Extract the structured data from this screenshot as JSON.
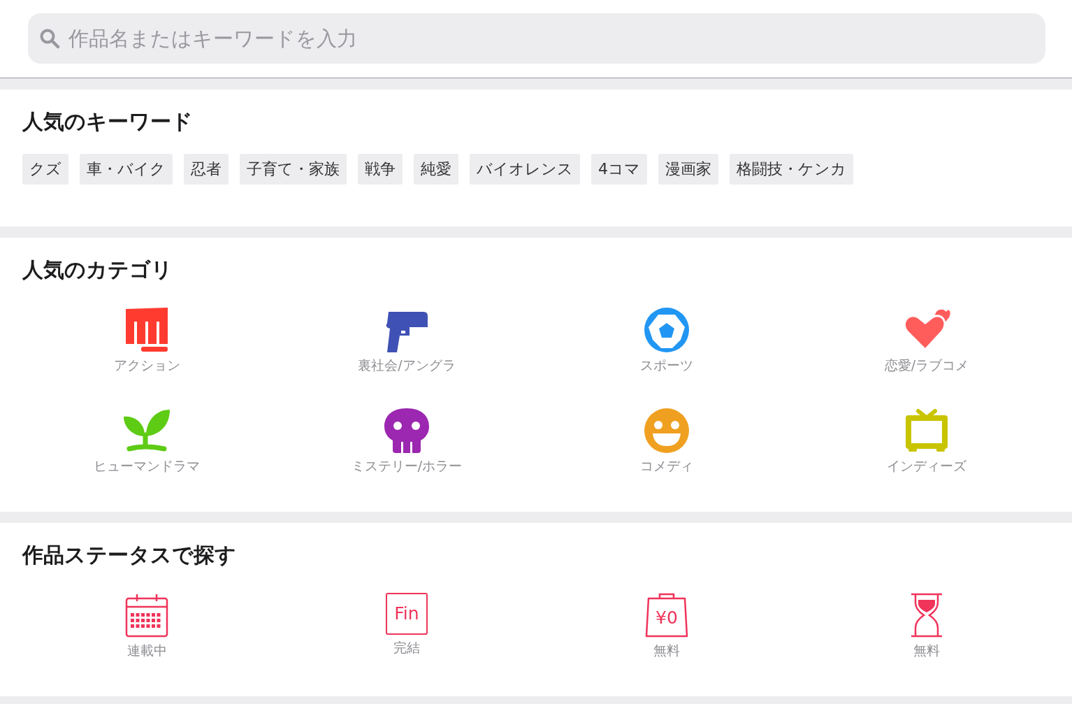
{
  "search": {
    "placeholder": "作品名またはキーワードを入力"
  },
  "keywords": {
    "title": "人気のキーワード",
    "items": [
      "クズ",
      "車・バイク",
      "忍者",
      "子育て・家族",
      "戦争",
      "純愛",
      "バイオレンス",
      "4コマ",
      "漫画家",
      "格闘技・ケンカ"
    ]
  },
  "categories": {
    "title": "人気のカテゴリ",
    "items": [
      {
        "kind": "fist",
        "label": "アクション",
        "color": "#ff3b30"
      },
      {
        "kind": "gun",
        "label": "裏社会/アングラ",
        "color": "#3f51b5"
      },
      {
        "kind": "ball",
        "label": "スポーツ",
        "color": "#2196f3"
      },
      {
        "kind": "hearts",
        "label": "恋愛/ラブコメ",
        "color": "#ff5c5c"
      },
      {
        "kind": "sprout",
        "label": "ヒューマンドラマ",
        "color": "#5ecb14"
      },
      {
        "kind": "skull",
        "label": "ミステリー/ホラー",
        "color": "#9c27b0"
      },
      {
        "kind": "smile",
        "label": "コメディ",
        "color": "#f0a020"
      },
      {
        "kind": "tv",
        "label": "インディーズ",
        "color": "#c8c400"
      }
    ]
  },
  "statuses": {
    "title": "作品ステータスで探す",
    "items": [
      {
        "kind": "calendar",
        "label": "連載中"
      },
      {
        "kind": "fin",
        "icon_text": "Fin",
        "label": "完結"
      },
      {
        "kind": "bag",
        "icon_text": "¥0",
        "label": "無料"
      },
      {
        "kind": "hourglass",
        "label": "無料"
      }
    ]
  }
}
